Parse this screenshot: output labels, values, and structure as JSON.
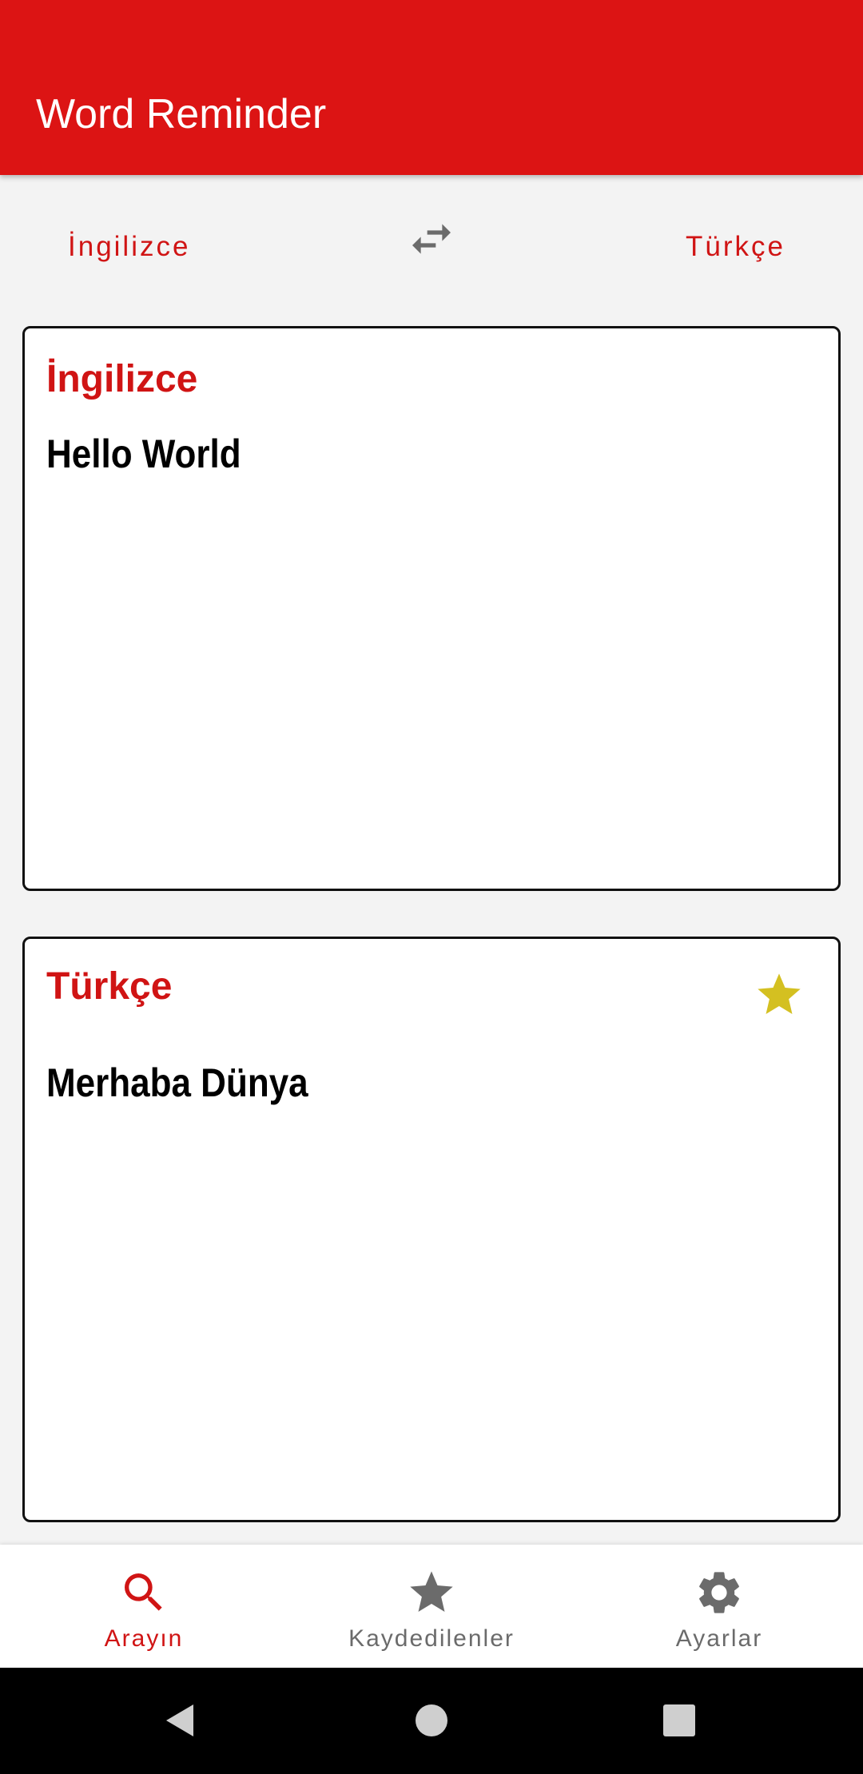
{
  "app": {
    "title": "Word Reminder",
    "colors": {
      "primary": "#dc1414",
      "accent_text": "#d01414",
      "star": "#d4c021",
      "inactive": "#6b6b6b",
      "background": "#f3f3f3"
    }
  },
  "language_selector": {
    "source_label": "İngilizce",
    "target_label": "Türkçe",
    "swap_icon": "swap-horizontal-icon"
  },
  "source_card": {
    "language": "İngilizce",
    "text": "Hello World"
  },
  "target_card": {
    "language": "Türkçe",
    "text": "Merhaba Dünya",
    "favorite_icon": "star-icon",
    "favorited": true
  },
  "bottom_nav": {
    "items": [
      {
        "label": "Arayın",
        "icon": "search-icon",
        "active": true
      },
      {
        "label": "Kaydedilenler",
        "icon": "star-icon",
        "active": false
      },
      {
        "label": "Ayarlar",
        "icon": "gear-icon",
        "active": false
      }
    ]
  },
  "system_nav": {
    "buttons": [
      "back-icon",
      "home-icon",
      "recents-icon"
    ]
  }
}
